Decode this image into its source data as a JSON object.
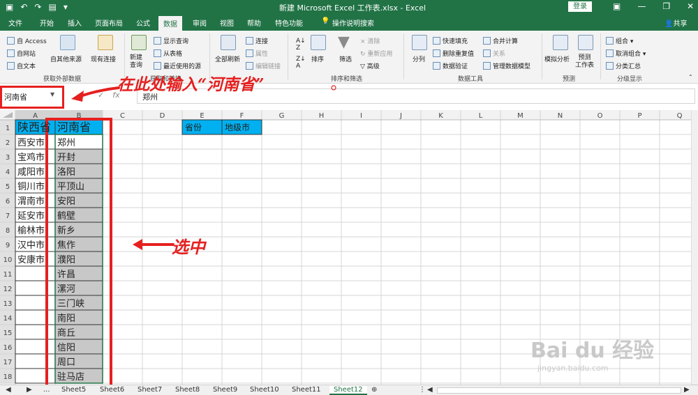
{
  "title_bar": {
    "title": "新建 Microsoft Excel 工作表.xlsx - Excel",
    "login": "登录"
  },
  "tabs": [
    "文件",
    "开始",
    "插入",
    "页面布局",
    "公式",
    "数据",
    "审阅",
    "视图",
    "帮助",
    "特色功能",
    "操作说明搜索"
  ],
  "active_tab": "数据",
  "share": "共享",
  "ribbon": {
    "ext_data": {
      "access": "自 Access",
      "web": "自网站",
      "text": "自文本",
      "other": "自其他来源",
      "existing": "现有连接",
      "group": "获取外部数据"
    },
    "transform": {
      "new_query": "新建\n查询",
      "show_query": "显示查询",
      "from_table": "从表格",
      "recent": "最近使用的源",
      "group": "获取和转换"
    },
    "connections": {
      "refresh_all": "全部刷新",
      "connections": "连接",
      "properties": "属性",
      "edit_links": "编辑链接",
      "group": "连接"
    },
    "sort_filter": {
      "sort": "排序",
      "filter": "筛选",
      "clear": "清除",
      "reapply": "重新应用",
      "advanced": "高级",
      "group": "排序和筛选"
    },
    "data_tools": {
      "split": "分列",
      "flash_fill": "快速填充",
      "remove_dup": "删除重复值",
      "validation": "数据验证",
      "consolidate": "合并计算",
      "relations": "关系",
      "manage_model": "管理数据模型",
      "group": "数据工具"
    },
    "forecast": {
      "what_if": "模拟分析",
      "forecast_sheet": "预测\n工作表",
      "group": "预测"
    },
    "outline": {
      "group_btn": "组合",
      "ungroup": "取消组合",
      "subtotal": "分类汇总",
      "group": "分级显示"
    }
  },
  "name_box": "河南省",
  "formula_value": "郑州",
  "annotations": {
    "top": "在此处输入“河南省”",
    "side": "选中"
  },
  "columns": [
    "A",
    "B",
    "C",
    "D",
    "E",
    "F",
    "G",
    "H",
    "I",
    "J",
    "K",
    "L",
    "M",
    "N",
    "O",
    "P",
    "Q"
  ],
  "rows": [
    "1",
    "2",
    "3",
    "4",
    "5",
    "6",
    "7",
    "8",
    "9",
    "10",
    "11",
    "12",
    "13",
    "14",
    "15",
    "16",
    "17",
    "18"
  ],
  "cells": {
    "A": [
      "陕西省",
      "西安市",
      "宝鸡市",
      "咸阳市",
      "铜川市",
      "渭南市",
      "延安市",
      "榆林市",
      "汉中市",
      "安康市",
      "",
      "",
      "",
      "",
      "",
      "",
      "",
      ""
    ],
    "B": [
      "河南省",
      "郑州",
      "开封",
      "洛阳",
      "平顶山",
      "安阳",
      "鹤壁",
      "新乡",
      "焦作",
      "濮阳",
      "许昌",
      "漯河",
      "三门峡",
      "南阳",
      "商丘",
      "信阳",
      "周口",
      "驻马店"
    ],
    "E1": "省份",
    "F1": "地级市"
  },
  "sheet_tabs": [
    "Sheet5",
    "Sheet6",
    "Sheet7",
    "Sheet8",
    "Sheet9",
    "Sheet10",
    "Sheet11",
    "Sheet12"
  ],
  "active_sheet": "Sheet12",
  "colors": {
    "excel_green": "#217346",
    "header_blue": "#00b0f0",
    "selection_gray": "#c8c8c8",
    "annotation_red": "#e52020"
  },
  "watermark": {
    "logo": "Bai du 经验",
    "url": "jingyan.baidu.com"
  }
}
